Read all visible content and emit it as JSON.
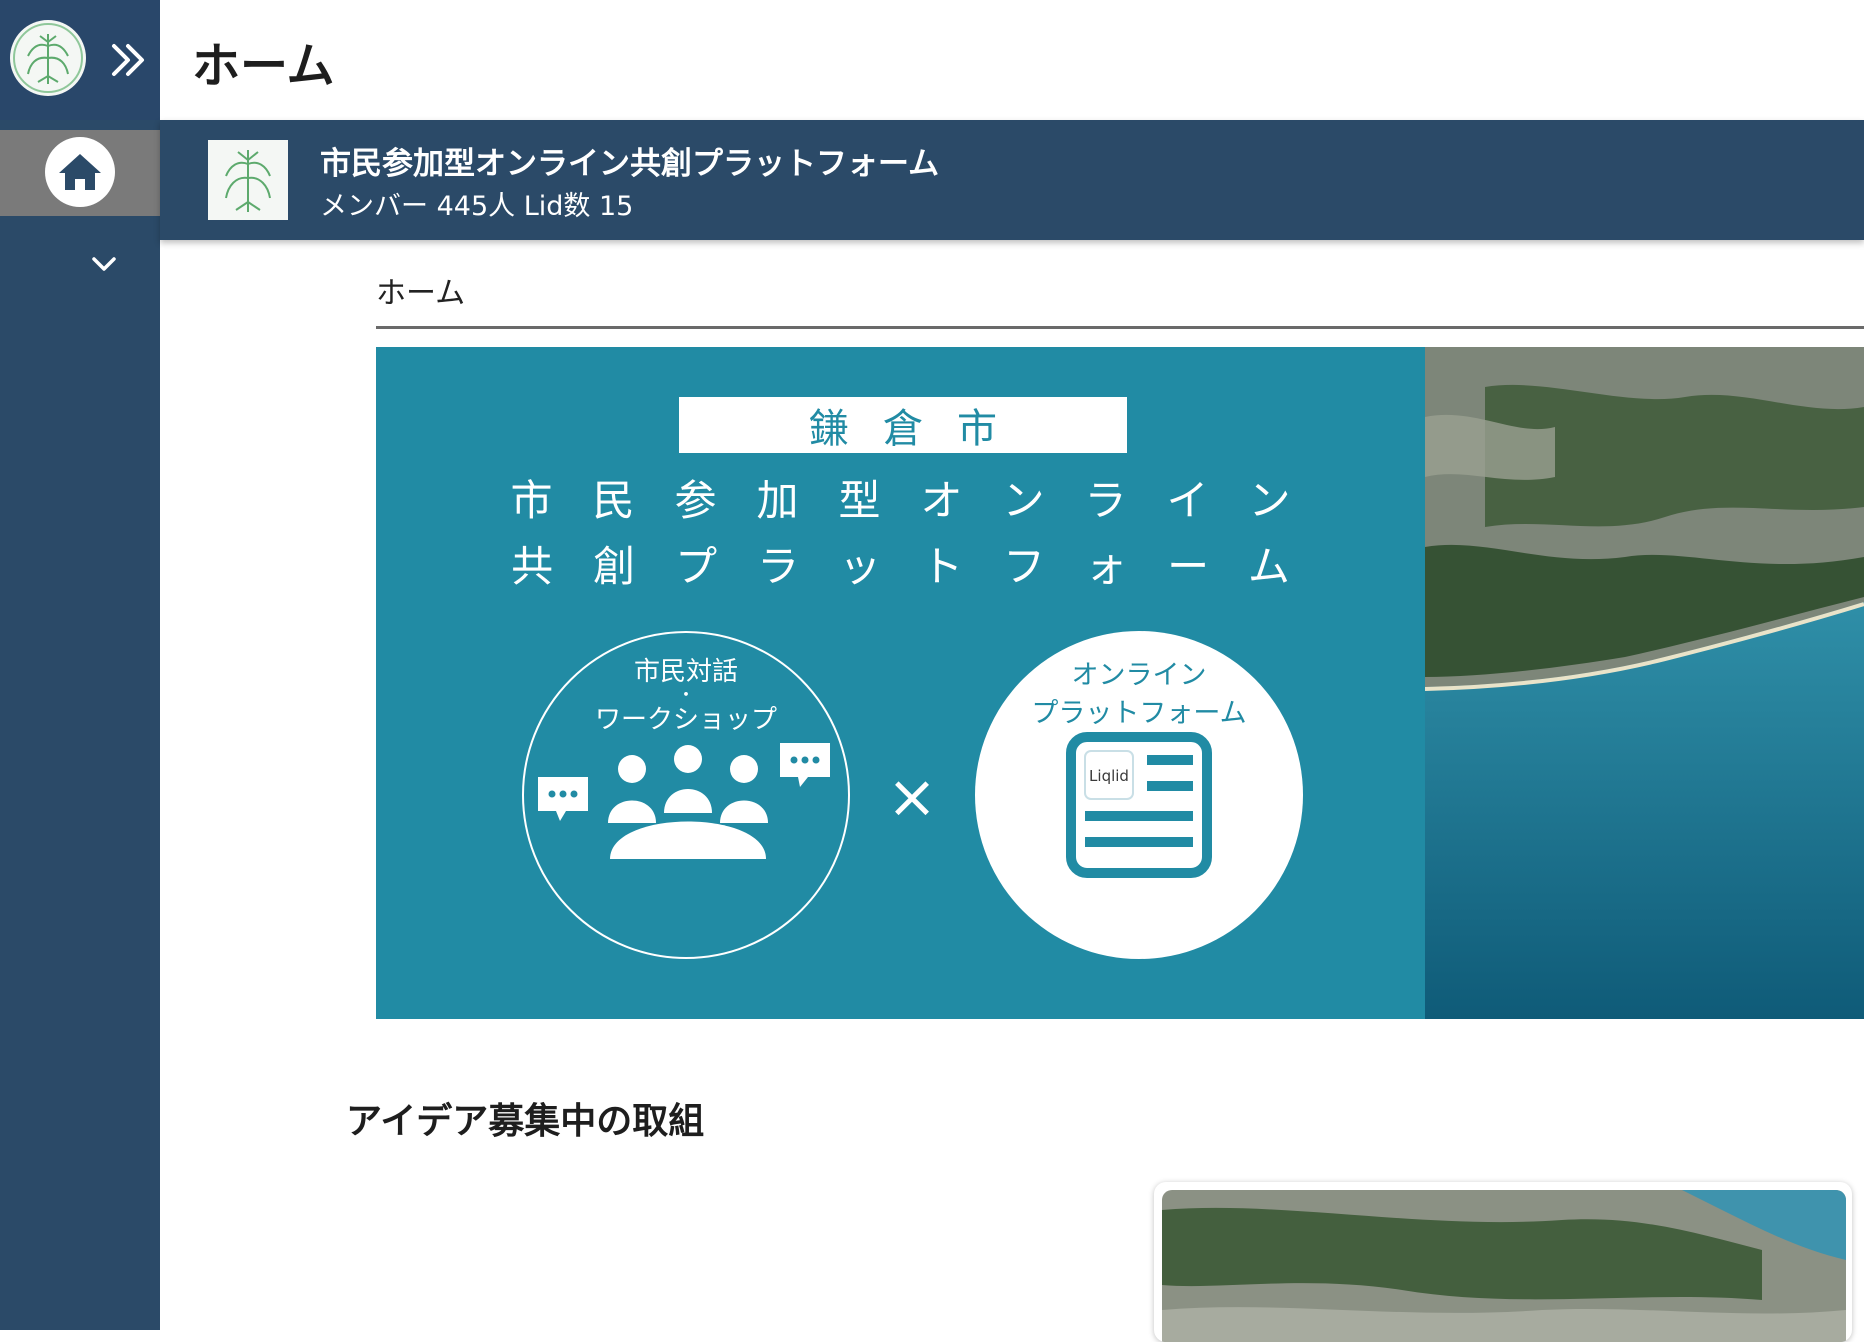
{
  "header": {
    "title": "ホーム"
  },
  "group": {
    "name": "市民参加型オンライン共創プラットフォーム",
    "meta": "メンバー 445人 Lid数 15"
  },
  "section": {
    "tab_label": "ホーム"
  },
  "hero": {
    "city": "鎌倉市",
    "title_line1": "市民参加型オンライン",
    "title_line2": "共創プラットフォーム",
    "left_circle_line1": "市民対話",
    "left_circle_dot": "・",
    "left_circle_line2": "ワークショップ",
    "times": "×",
    "right_circle_line1": "オンライン",
    "right_circle_line2": "プラットフォーム",
    "app_logo": "Liqlid"
  },
  "ideas": {
    "heading": "アイデア募集中の取組"
  },
  "colors": {
    "sidebar": "#2b4a68",
    "banner": "#2b4a68",
    "hero_teal": "#218ba4",
    "home_active": "#7a7a7a"
  },
  "icons": {
    "expand": "double-chevron-right-icon",
    "home": "home-icon",
    "dropdown": "chevron-down-icon",
    "logo": "bamboo-emblem-icon"
  }
}
